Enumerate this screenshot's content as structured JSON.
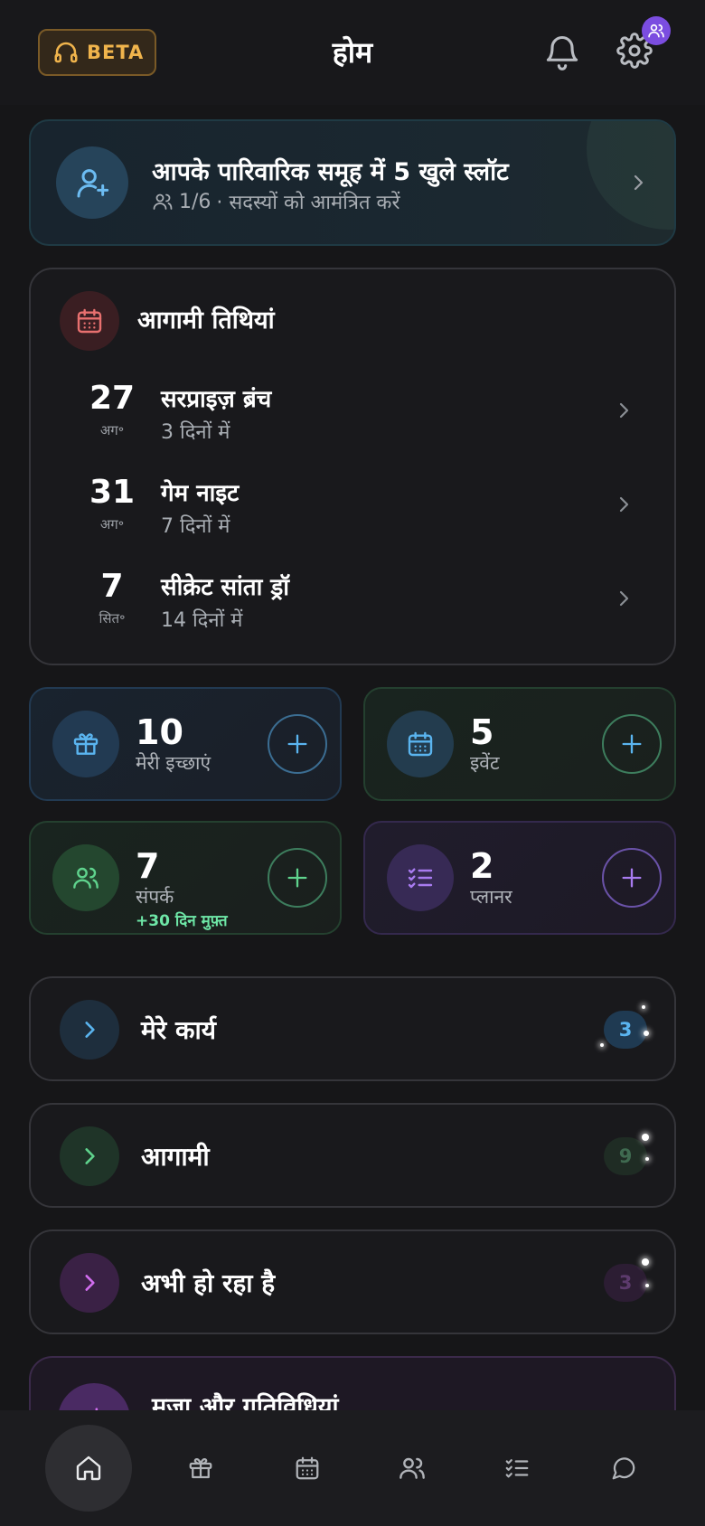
{
  "header": {
    "beta_label": "BETA",
    "title": "होम"
  },
  "invite": {
    "title": "आपके पारिवारिक समूह में 5 खुले स्लॉट",
    "count": "1/6",
    "subtitle": "· सदस्यों को आमंत्रित करें"
  },
  "upcoming_dates": {
    "heading": "आगामी तिथियां",
    "events": [
      {
        "day": "27",
        "month": "अग॰",
        "name": "सरप्राइज़ ब्रंच",
        "when": "3 दिनों में"
      },
      {
        "day": "31",
        "month": "अग॰",
        "name": "गेम नाइट",
        "when": "7 दिनों में"
      },
      {
        "day": "7",
        "month": "सित॰",
        "name": "सीक्रेट सांता ड्रॉ",
        "when": "14 दिनों में"
      }
    ]
  },
  "stats": {
    "wishes": {
      "count": "10",
      "label": "मेरी इच्छाएं"
    },
    "events": {
      "count": "5",
      "label": "इवेंट"
    },
    "contacts": {
      "count": "7",
      "label": "संपर्क",
      "extra": "+30 दिन मुफ़्त"
    },
    "planner": {
      "count": "2",
      "label": "प्लानर"
    }
  },
  "sections": {
    "my_tasks": {
      "label": "मेरे कार्य",
      "count": "3"
    },
    "upcoming": {
      "label": "आगामी",
      "count": "9"
    },
    "happening_now": {
      "label": "अभी हो रहा है",
      "count": "3"
    },
    "fun": {
      "label": "मजा और गतिविधियां"
    }
  },
  "bottom_nav": {
    "items": [
      "home-icon",
      "gift-icon",
      "calendar-icon",
      "users-icon",
      "list-check-icon",
      "chat-icon"
    ],
    "active": "home-icon"
  },
  "colors": {
    "background": "#161618",
    "beta_accent": "#f0b44c",
    "blue_accent": "#5ab4ef",
    "green_accent": "#5fd38d",
    "purple_accent": "#a87bf0",
    "pink_accent": "#d26ef0",
    "red_accent": "#e8706f",
    "badge": "#7b4de0"
  }
}
